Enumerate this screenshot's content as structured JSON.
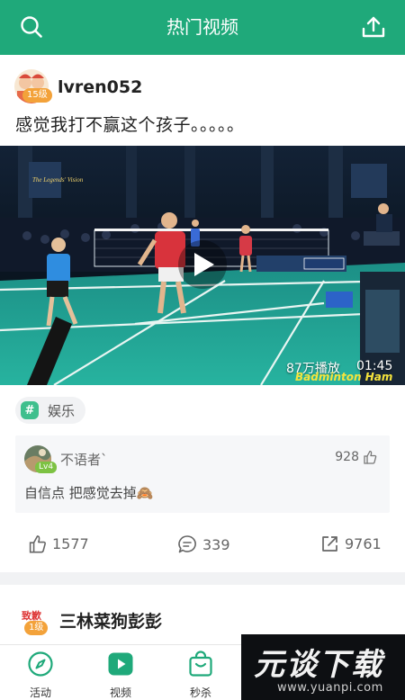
{
  "header": {
    "title": "热门视频",
    "search_icon": "search-icon",
    "upload_icon": "upload-icon"
  },
  "post": {
    "username": "lvren052",
    "level": "15级",
    "text": "感觉我打不赢这个孩子。。。。。",
    "video": {
      "plays": "87万播放",
      "duration": "01:45",
      "watermark": "Badminton Ham",
      "arena_sign": "The Legends' Vision"
    },
    "tag": "娱乐",
    "top_comment": {
      "author": "不语者`",
      "level": "Lv4",
      "likes": "928",
      "text": "自信点 把感觉去掉🙈"
    },
    "actions": {
      "likes": "1577",
      "comments": "339",
      "shares": "9761"
    }
  },
  "next_post": {
    "username": "三林菜狗彭彭",
    "level": "1级",
    "avatar_text": "致歉"
  },
  "tabbar": {
    "items": [
      {
        "label": "活动",
        "icon": "compass-icon"
      },
      {
        "label": "视频",
        "icon": "video-play-icon"
      },
      {
        "label": "秒杀",
        "icon": "shopping-bag-icon"
      }
    ]
  },
  "banner": {
    "main": "元谈下载",
    "url": "www.yuanpi.com"
  },
  "colors": {
    "brand": "#1fa97a",
    "level_badge": "#f3a23a",
    "comment_level": "#7dc243",
    "tag_icon": "#3fbf8d"
  }
}
